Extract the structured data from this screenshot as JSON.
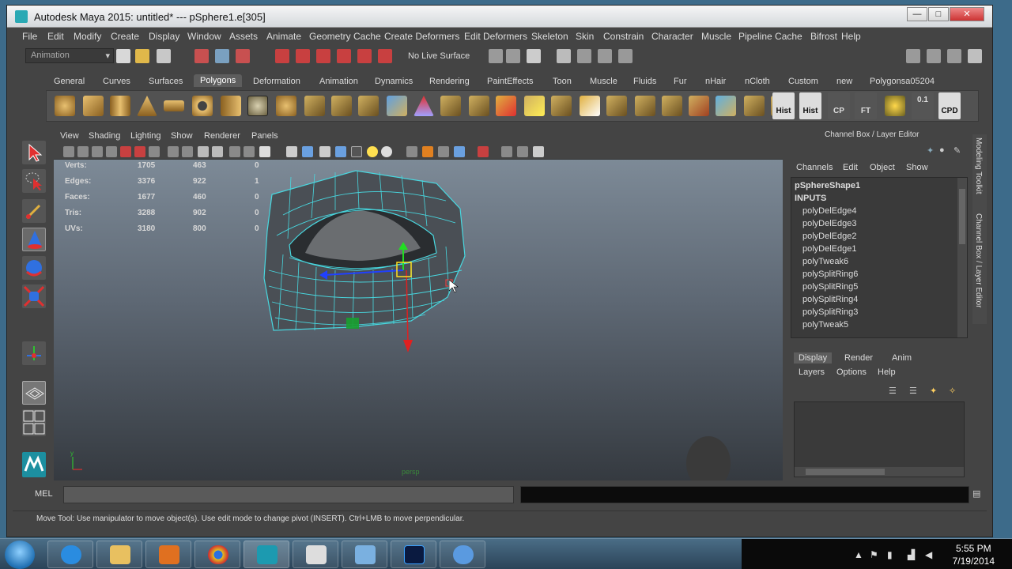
{
  "window": {
    "title": "Autodesk Maya 2015: untitled*   ---   pSphere1.e[305]",
    "controls": {
      "minimize": "—",
      "maximize": "□",
      "close": "✕"
    }
  },
  "menubar": [
    "File",
    "Edit",
    "Modify",
    "Create",
    "Display",
    "Window",
    "Assets",
    "Animate",
    "Geometry Cache",
    "Create Deformers",
    "Edit Deformers",
    "Skeleton",
    "Skin",
    "Constrain",
    "Character",
    "Muscle",
    "Pipeline Cache",
    "Bifrost",
    "Help"
  ],
  "status_line": {
    "mode": "Animation",
    "live_surface": "No Live Surface"
  },
  "shelf_tabs": [
    "General",
    "Curves",
    "Surfaces",
    "Polygons",
    "Deformation",
    "Animation",
    "Dynamics",
    "Rendering",
    "PaintEffects",
    "Toon",
    "Muscle",
    "Fluids",
    "Fur",
    "nHair",
    "nCloth",
    "Custom",
    "new",
    "Polygonsa05204"
  ],
  "shelf_active": "Polygons",
  "shelf_labels": {
    "hist1": "Hist",
    "hist2": "Hist",
    "cp": "CP",
    "ft": "FT",
    "cpd": "CPD",
    "num": "0.1"
  },
  "viewport": {
    "menu": [
      "View",
      "Shading",
      "Lighting",
      "Show",
      "Renderer",
      "Panels"
    ],
    "hud": [
      {
        "label": "Verts:",
        "a": "1705",
        "b": "463",
        "c": "0"
      },
      {
        "label": "Edges:",
        "a": "3376",
        "b": "922",
        "c": "1"
      },
      {
        "label": "Faces:",
        "a": "1677",
        "b": "460",
        "c": "0"
      },
      {
        "label": "Tris:",
        "a": "3288",
        "b": "902",
        "c": "0"
      },
      {
        "label": "UVs:",
        "a": "3180",
        "b": "800",
        "c": "0"
      }
    ],
    "camera_label": "persp",
    "axis": {
      "y": "y",
      "x": "x"
    }
  },
  "channel_box": {
    "title": "Channel Box / Layer Editor",
    "menu": [
      "Channels",
      "Edit",
      "Object",
      "Show"
    ],
    "shape": "pSphereShape1",
    "inputs_label": "INPUTS",
    "inputs": [
      "polyDelEdge4",
      "polyDelEdge3",
      "polyDelEdge2",
      "polyDelEdge1",
      "polyTweak6",
      "polySplitRing6",
      "polySplitRing5",
      "polySplitRing4",
      "polySplitRing3",
      "polyTweak5"
    ]
  },
  "layer_editor": {
    "tabs": [
      "Display",
      "Render",
      "Anim"
    ],
    "active_tab": "Display",
    "menu": [
      "Layers",
      "Options",
      "Help"
    ]
  },
  "side_tabs": [
    "Modeling Toolkit",
    "Channel Box / Layer Editor"
  ],
  "command_line": {
    "label": "MEL"
  },
  "help_line": "Move Tool: Use manipulator to move object(s). Use edit mode to change pivot (INSERT). Ctrl+LMB to move perpendicular.",
  "taskbar": {
    "time": "5:55 PM",
    "date": "7/19/2014",
    "apps": [
      "internet-explorer",
      "file-explorer",
      "media-player",
      "chrome",
      "maya",
      "zbrush",
      "photo-viewer",
      "photoshop",
      "flower-app"
    ]
  },
  "colors": {
    "mesh_wire": "#48d8e0",
    "manip_y": "#22dd22",
    "manip_x": "#e02020",
    "manip_z": "#2040ff"
  }
}
